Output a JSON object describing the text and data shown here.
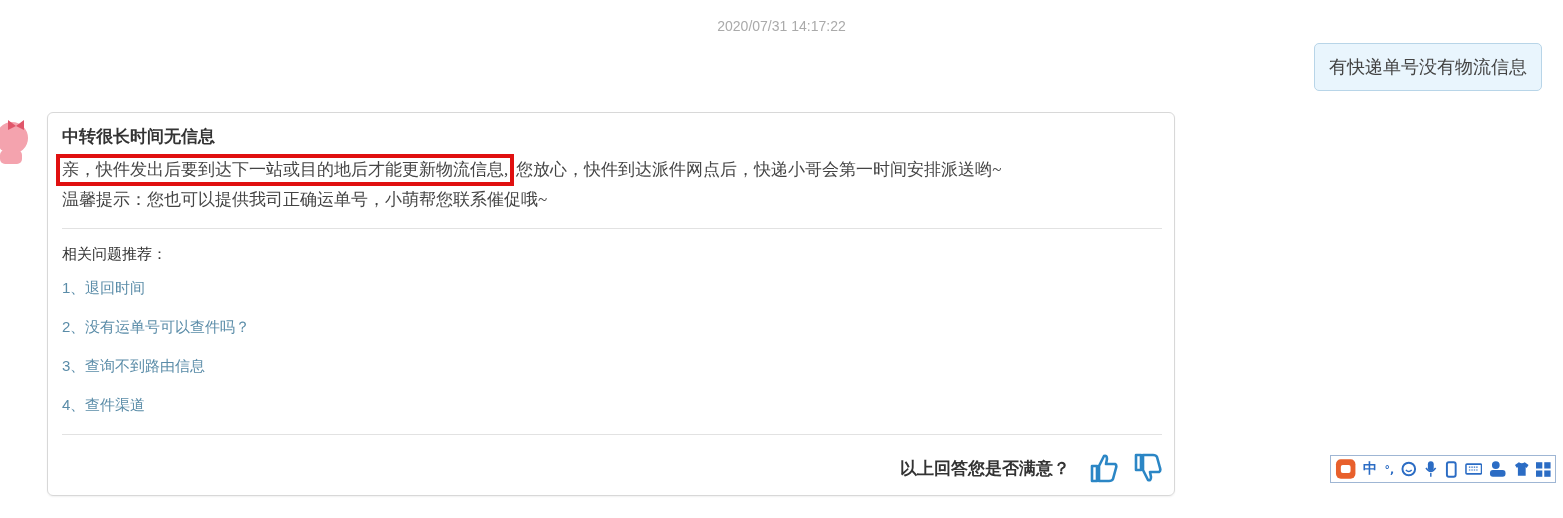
{
  "timestamp": "2020/07/31 14:17:22",
  "user_message": {
    "text": "有快递单号没有物流信息"
  },
  "bot_message": {
    "title": "中转很长时间无信息",
    "lines": [
      {
        "highlight": "亲，快件发出后要到达下一站或目的地后才能更新物流信息,",
        "text": "您放心，快件到达派件网点后，快递小哥会第一时间安排派送哟~"
      },
      {
        "text": "温馨提示：您也可以提供我司正确运单号，小萌帮您联系催促哦~"
      }
    ],
    "related": {
      "heading": "相关问题推荐：",
      "items": [
        "1、退回时间",
        "2、没有运单号可以查件吗？",
        "3、查询不到路由信息",
        "4、查件渠道"
      ]
    },
    "feedback": {
      "question": "以上回答您是否满意？"
    }
  },
  "ime_toolbar": {
    "mode": "中",
    "punctuation": "°,"
  }
}
